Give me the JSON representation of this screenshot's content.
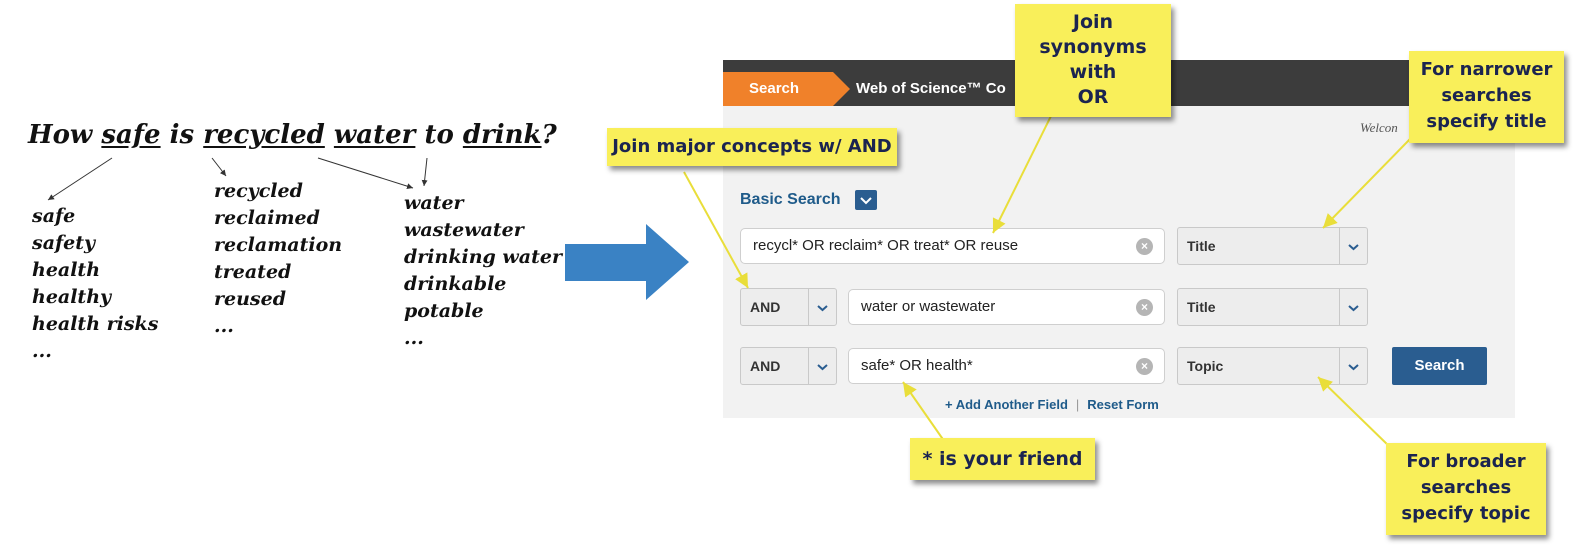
{
  "question": {
    "prefix": "How",
    "w1": "safe",
    "mid1": "is",
    "w2": "recycled",
    "w3": "water",
    "mid2": "to",
    "w4": "drink",
    "suffix": "?"
  },
  "term_columns": [
    [
      "safe",
      "safety",
      "health",
      "healthy",
      "health risks",
      "..."
    ],
    [
      "recycled",
      "reclaimed",
      "reclamation",
      "treated",
      "reused",
      "..."
    ],
    [
      "water",
      "wastewater",
      "drinking water",
      "drinkable",
      "potable",
      "..."
    ]
  ],
  "wos": {
    "tab_label": "Search",
    "product_title": "Web of Science™ Co",
    "welcome": "Welcon",
    "basic_search": "Basic Search",
    "rows": [
      {
        "operator": "",
        "query": "recycl* OR reclaim* OR treat* OR reuse",
        "field": "Title"
      },
      {
        "operator": "AND",
        "query": "water or wastewater",
        "field": "Title"
      },
      {
        "operator": "AND",
        "query": "safe* OR health*",
        "field": "Topic"
      }
    ],
    "search_button": "Search",
    "add_field": "+ Add Another Field",
    "reset_form": "Reset Form"
  },
  "callouts": {
    "synonyms": [
      "Join",
      "synonyms",
      "with",
      "OR"
    ],
    "concepts": "Join major concepts w/ AND",
    "narrower": [
      "For narrower",
      "searches",
      "specify title"
    ],
    "wildcard": "* is your friend",
    "broader": [
      "For broader",
      "searches",
      "specify topic"
    ]
  },
  "colors": {
    "arrow_blue": "#3a82c4",
    "note_yellow": "#f9ef5a",
    "tab_orange": "#f0812a",
    "wos_blue": "#2a5d90"
  }
}
